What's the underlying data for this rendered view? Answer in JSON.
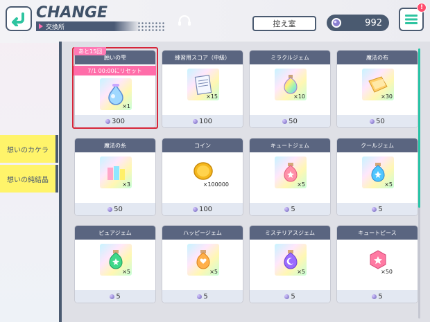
{
  "header": {
    "title": "CHANGE",
    "subtitle": "交換所",
    "hikaeshitsu_label": "控え室",
    "currency_amount": "992",
    "notification_badge": "!"
  },
  "sidebar": {
    "tabs": [
      {
        "label": "想いのカケラ"
      },
      {
        "label": "想いの純結晶"
      }
    ]
  },
  "items": [
    {
      "name": "願いの雫",
      "qty": "×1",
      "price": "300",
      "remaining": "あと15回",
      "reset": "7/1 00:00にリセット",
      "icon": "wish-drop-icon"
    },
    {
      "name": "練習用スコア（中級）",
      "qty": "×15",
      "price": "100",
      "icon": "practice-score-icon"
    },
    {
      "name": "ミラクルジェム",
      "qty": "×10",
      "price": "50",
      "icon": "miracle-gem-icon"
    },
    {
      "name": "魔法の布",
      "qty": "×30",
      "price": "50",
      "icon": "magic-cloth-icon"
    },
    {
      "name": "魔法の糸",
      "qty": "×3",
      "price": "50",
      "icon": "magic-thread-icon"
    },
    {
      "name": "コイン",
      "qty": "×100000",
      "price": "100",
      "icon": "coin-icon"
    },
    {
      "name": "キュートジェム",
      "qty": "×5",
      "price": "5",
      "icon": "cute-gem-icon"
    },
    {
      "name": "クールジェム",
      "qty": "×5",
      "price": "5",
      "icon": "cool-gem-icon"
    },
    {
      "name": "ピュアジェム",
      "qty": "×5",
      "price": "5",
      "icon": "pure-gem-icon"
    },
    {
      "name": "ハッピージェム",
      "qty": "×5",
      "price": "5",
      "icon": "happy-gem-icon"
    },
    {
      "name": "ミステリアスジェム",
      "qty": "×5",
      "price": "5",
      "icon": "mysterious-gem-icon"
    },
    {
      "name": "キュートピース",
      "qty": "×50",
      "price": "5",
      "icon": "cute-piece-icon"
    }
  ],
  "colors": {
    "accent_dark": "#4a5a70",
    "pink": "#ff6da9",
    "yellow_tab": "#fff46a",
    "highlight_red": "#d6263a",
    "scroll_teal": "#28c3a5"
  }
}
